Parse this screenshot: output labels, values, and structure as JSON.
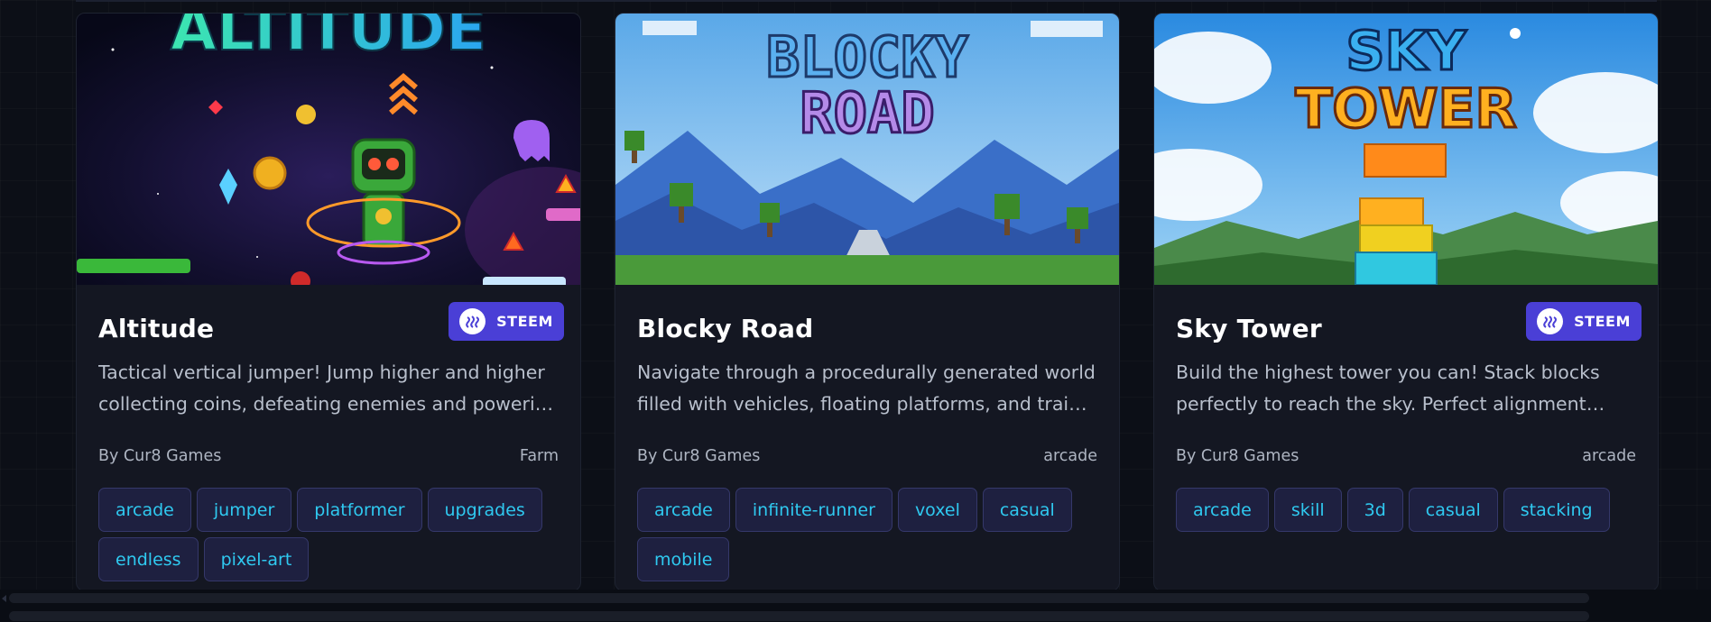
{
  "cards": [
    {
      "title": "Altitude",
      "badge": "STEEM",
      "description": "Tactical vertical jumper! Jump higher and higher collecting coins, defeating enemies and powering up with upgrades as you climb.",
      "author": "By Cur8 Games",
      "category": "Farm",
      "tags": [
        "arcade",
        "jumper",
        "platformer",
        "upgrades",
        "endless",
        "pixel-art"
      ],
      "thumb_text": "ALTITUDE"
    },
    {
      "title": "Blocky Road",
      "badge": "",
      "description": "Navigate through a procedurally generated world filled with vehicles, floating platforms, and trains. Dodge traffic and keep moving.",
      "author": "By Cur8 Games",
      "category": "arcade",
      "tags": [
        "arcade",
        "infinite-runner",
        "voxel",
        "casual",
        "mobile"
      ],
      "thumb_text_line1": "BLOCKY",
      "thumb_text_line2": "ROAD"
    },
    {
      "title": "Sky Tower",
      "badge": "STEEM",
      "description": "Build the highest tower you can! Stack blocks perfectly to reach the sky. Perfect alignment keeps your tower growing taller.",
      "author": "By Cur8 Games",
      "category": "arcade",
      "tags": [
        "arcade",
        "skill",
        "3d",
        "casual",
        "stacking"
      ],
      "thumb_text_line1": "SKY",
      "thumb_text_line2": "TOWER"
    }
  ],
  "colors": {
    "background": "#0c0f17",
    "card": "#141722",
    "badge": "#4a3fd6",
    "tag_text": "#2fc9f0",
    "tag_bg": "#1e2040"
  },
  "icons": {
    "badge": "steem-logo-icon"
  }
}
